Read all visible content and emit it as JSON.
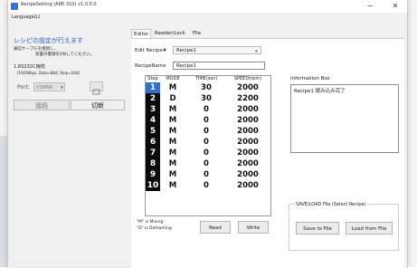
{
  "window": {
    "title": "RecipeSetting (ARE-310) v1.0.0.0",
    "minimize": "−",
    "close": "✕"
  },
  "menu": {
    "language": "Language(L)"
  },
  "status": {
    "title": "レシピの設定が行えます",
    "line1": "通信ケーブルを接続し、",
    "line2": "装置の電源をONしてください。"
  },
  "serial": {
    "title": "1.RS232C接続",
    "params": "[19200bps, Data=8bit, Stop=1bit]",
    "port_label": "Port:",
    "port_value": "COM99",
    "connect": "接続",
    "disconnect": "切断"
  },
  "tabs": [
    "Editor",
    "Reader/Lock",
    "File"
  ],
  "editor": {
    "edit_recipe_label": "Edit Recipe#",
    "edit_recipe_value": "Recipe1",
    "recipe_name_label": "RecipeName",
    "recipe_name_value": "Recipe1",
    "columns": [
      "Step",
      "MODE",
      "TIME(sec)",
      "SPEED(rpm)"
    ],
    "rows": [
      [
        "1",
        "M",
        "30",
        "2000"
      ],
      [
        "2",
        "D",
        "30",
        "2200"
      ],
      [
        "3",
        "M",
        "0",
        "2000"
      ],
      [
        "4",
        "M",
        "0",
        "2000"
      ],
      [
        "5",
        "M",
        "0",
        "2000"
      ],
      [
        "6",
        "M",
        "0",
        "2000"
      ],
      [
        "7",
        "M",
        "0",
        "2000"
      ],
      [
        "8",
        "M",
        "0",
        "2000"
      ],
      [
        "9",
        "M",
        "0",
        "2000"
      ],
      [
        "10",
        "M",
        "0",
        "2000"
      ]
    ],
    "legend_mixing": "\"M\" is Mixing",
    "legend_defoaming": "\"D\" is Defoaming",
    "read": "Read",
    "write": "Write"
  },
  "info": {
    "title": "Information Box",
    "message": "Recipe1 読み込み完了"
  },
  "save_load": {
    "title": "SAVE/LOAD File (Select Recipe)",
    "save": "Save to File",
    "load": "Load from File"
  },
  "colors": {
    "accent": "#2a5ad8",
    "step_bg": "#0b0b0b",
    "step_selected": "#2f6fcf"
  }
}
